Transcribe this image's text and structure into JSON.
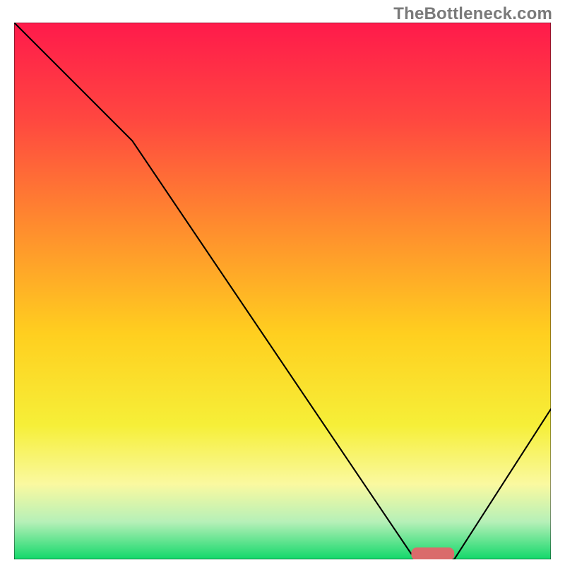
{
  "watermark": "TheBottleneck.com",
  "colors": {
    "line": "#000000",
    "border": "#000000",
    "marker": "#da6b6b",
    "gradient_stops": [
      {
        "offset": 0.0,
        "color": "#ff1a4b"
      },
      {
        "offset": 0.18,
        "color": "#ff4740"
      },
      {
        "offset": 0.38,
        "color": "#ff8c2e"
      },
      {
        "offset": 0.58,
        "color": "#ffcf1f"
      },
      {
        "offset": 0.75,
        "color": "#f6ef38"
      },
      {
        "offset": 0.86,
        "color": "#faf9a0"
      },
      {
        "offset": 0.93,
        "color": "#b6f0b8"
      },
      {
        "offset": 1.0,
        "color": "#12d86a"
      }
    ]
  },
  "chart_data": {
    "type": "line",
    "title": "",
    "xlabel": "",
    "ylabel": "",
    "xlim": [
      0,
      100
    ],
    "ylim": [
      0,
      100
    ],
    "series": [
      {
        "name": "curve",
        "x": [
          0,
          22,
          74,
          80,
          82,
          100
        ],
        "y": [
          100,
          78,
          1,
          0,
          0,
          28
        ]
      }
    ],
    "marker": {
      "x_start": 74,
      "x_end": 82,
      "y": 1,
      "radius_y": 1.2
    }
  }
}
